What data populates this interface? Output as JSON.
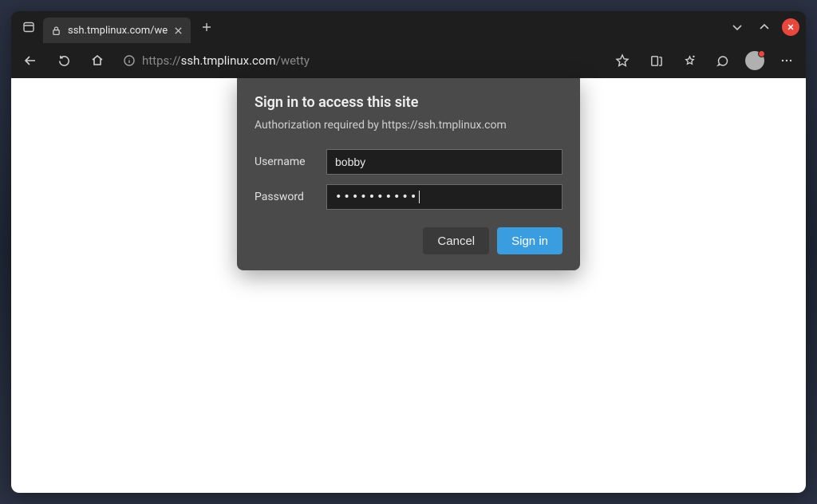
{
  "tab": {
    "title": "ssh.tmplinux.com/we"
  },
  "url": {
    "protocol": "https://",
    "host": "ssh.tmplinux.com",
    "path": "/wetty"
  },
  "dialog": {
    "title": "Sign in to access this site",
    "subtitle": "Authorization required by https://ssh.tmplinux.com",
    "username_label": "Username",
    "username_value": "bobby",
    "password_label": "Password",
    "password_masked": "••••••••••",
    "cancel_label": "Cancel",
    "signin_label": "Sign in"
  }
}
